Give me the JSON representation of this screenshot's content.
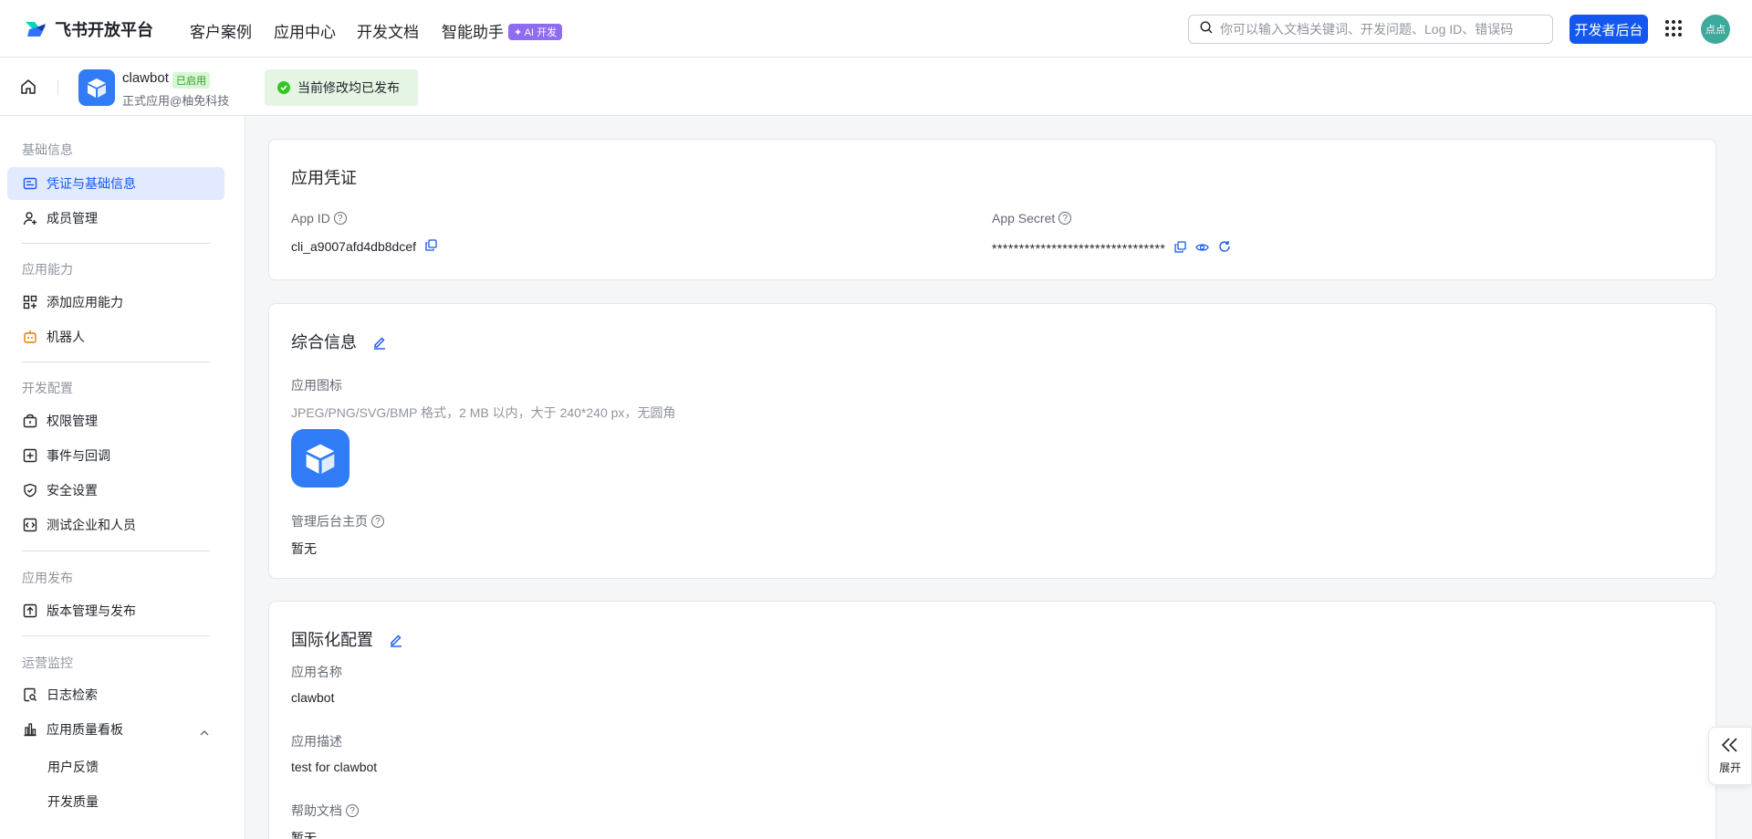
{
  "brand": {
    "name": "飞书开放平台"
  },
  "nav": {
    "links": [
      "客户案例",
      "应用中心",
      "开发文档",
      "智能助手"
    ],
    "ai_badge": "✦ AI 开发",
    "search_placeholder": "你可以输入文档关键词、开发问题、Log ID、错误码",
    "dev_console": "开发者后台",
    "avatar_text": "点点"
  },
  "app": {
    "name": "clawbot",
    "status": "已启用",
    "subtitle": "正式应用@柚免科技",
    "publish_status": "当前修改均已发布"
  },
  "sidebar": {
    "sections": [
      {
        "title": "基础信息",
        "items": [
          "凭证与基础信息",
          "成员管理"
        ]
      },
      {
        "title": "应用能力",
        "items": [
          "添加应用能力",
          "机器人"
        ]
      },
      {
        "title": "开发配置",
        "items": [
          "权限管理",
          "事件与回调",
          "安全设置",
          "测试企业和人员"
        ]
      },
      {
        "title": "应用发布",
        "items": [
          "版本管理与发布"
        ]
      },
      {
        "title": "运营监控",
        "items": [
          "日志检索",
          "应用质量看板"
        ],
        "subitems": [
          "用户反馈",
          "开发质量"
        ]
      }
    ]
  },
  "credentials": {
    "title": "应用凭证",
    "app_id_label": "App ID",
    "app_id": "cli_a9007afd4db8dcef",
    "secret_label": "App Secret",
    "secret": "********************************"
  },
  "general": {
    "title": "综合信息",
    "icon_label": "应用图标",
    "icon_hint": "JPEG/PNG/SVG/BMP 格式，2 MB 以内，大于 240*240 px，无圆角",
    "admin_home_label": "管理后台主页",
    "admin_home_value": "暂无"
  },
  "i18n": {
    "title": "国际化配置",
    "name_label": "应用名称",
    "name_value": "clawbot",
    "desc_label": "应用描述",
    "desc_value": "test for clawbot",
    "help_label": "帮助文档",
    "help_value": "暂无"
  },
  "expand": {
    "label": "展开"
  },
  "colors": {
    "primary": "#1456f0",
    "active_bg": "#e1eaff",
    "success": "#34c724"
  }
}
